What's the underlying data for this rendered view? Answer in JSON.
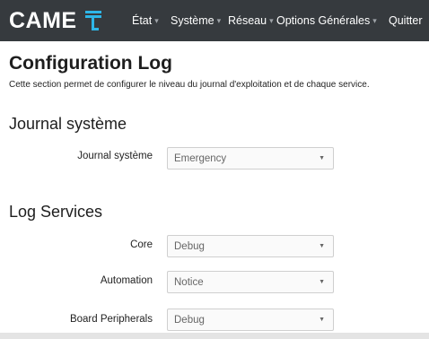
{
  "header": {
    "logo_text": "CAME",
    "nav": [
      {
        "label": "État"
      },
      {
        "label": "Système"
      },
      {
        "label": "Réseau"
      },
      {
        "label": "Options Générales"
      },
      {
        "label": "Quitter"
      }
    ]
  },
  "page": {
    "title": "Configuration Log",
    "description": "Cette section permet de configurer le niveau du journal d'exploitation et de chaque service."
  },
  "journal": {
    "section_title": "Journal système",
    "label": "Journal système",
    "value": "Emergency"
  },
  "services": {
    "section_title": "Log Services",
    "rows": [
      {
        "label": "Core",
        "value": "Debug"
      },
      {
        "label": "Automation",
        "value": "Notice"
      },
      {
        "label": "Board Peripherals",
        "value": "Debug"
      }
    ]
  },
  "colors": {
    "topbar": "#363a3e",
    "logo_accent": "#2eb6e8"
  }
}
